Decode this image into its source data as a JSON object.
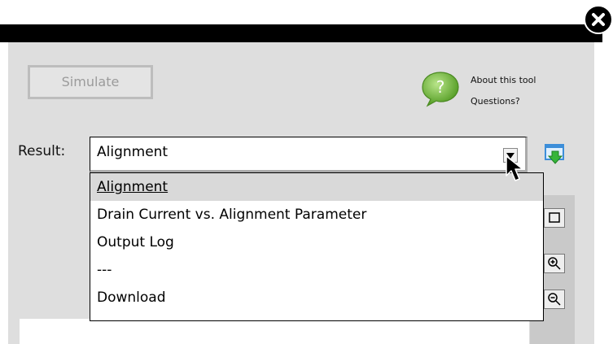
{
  "toolbar": {
    "simulate_label": "Simulate",
    "help": {
      "line1": "About this tool",
      "line2": "Questions?"
    }
  },
  "result": {
    "label": "Result:",
    "selected": "Alignment",
    "options": [
      "Alignment",
      "Drain Current vs. Alignment Parameter",
      "Output Log",
      "---",
      "Download"
    ]
  },
  "icons": {
    "close": "close-icon",
    "help": "help-question-icon",
    "download": "download-icon",
    "dropdown_arrow": "chevron-down-icon",
    "tools": [
      "maximize-icon",
      "zoom-in-icon",
      "zoom-out-icon"
    ]
  },
  "colors": {
    "topbar": "#000000",
    "panel": "#dedede",
    "help_green": "#7ac142",
    "download_blue": "#3c8ed9",
    "download_green": "#35b53a"
  }
}
